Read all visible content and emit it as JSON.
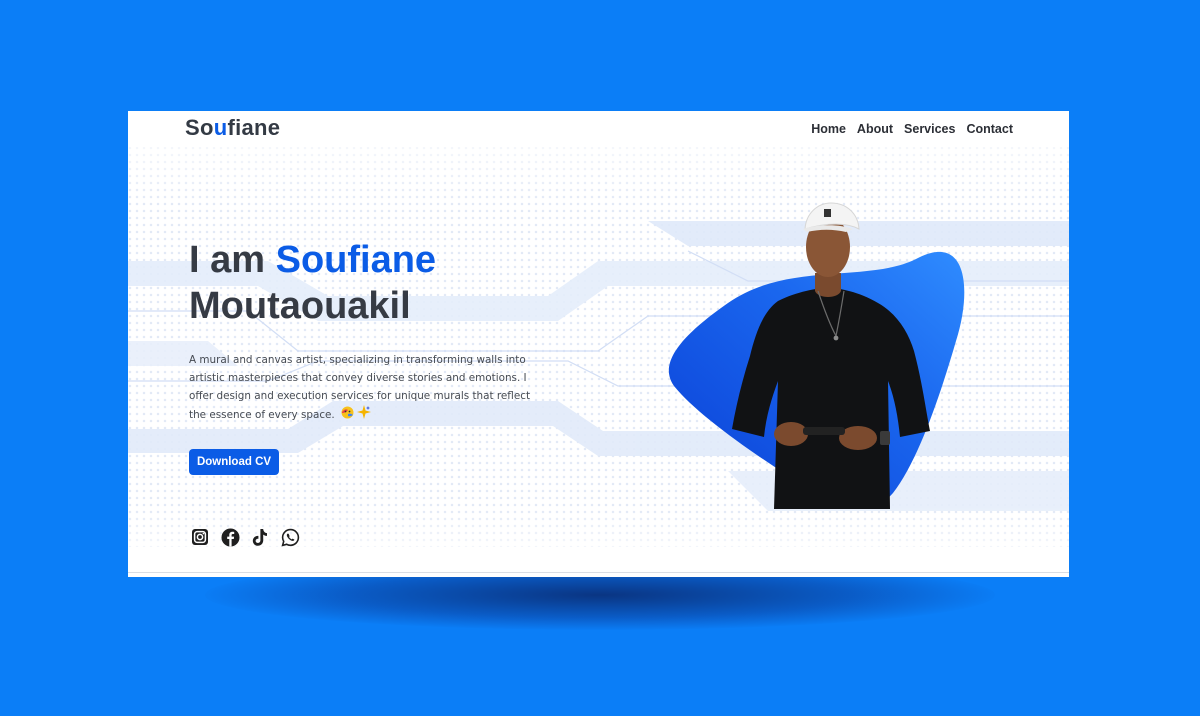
{
  "brand": {
    "name_start": "So",
    "name_accent": "u",
    "name_end": "fiane"
  },
  "nav": {
    "items": [
      "Home",
      "About",
      "Services",
      "Contact"
    ]
  },
  "hero": {
    "intro": "I am ",
    "first_name": "Soufiane",
    "last_name": "Moutaouakil",
    "description": "A mural and canvas artist, specializing in transforming walls into artistic masterpieces that convey diverse stories and emotions. I offer design and execution services for unique murals that reflect the essence of every space.",
    "emoji_icons": [
      "painted-face-icon",
      "sparkles-icon"
    ],
    "cv_button": "Download CV"
  },
  "socials": [
    "instagram-icon",
    "facebook-icon",
    "tiktok-icon",
    "whatsapp-icon"
  ],
  "colors": {
    "page_background": "#0b7ef7",
    "accent": "#0b5ce6",
    "heading": "#363b44",
    "body_text": "#454a52",
    "blob_dark": "#0a3fd6",
    "blob_light": "#2f8cff"
  }
}
